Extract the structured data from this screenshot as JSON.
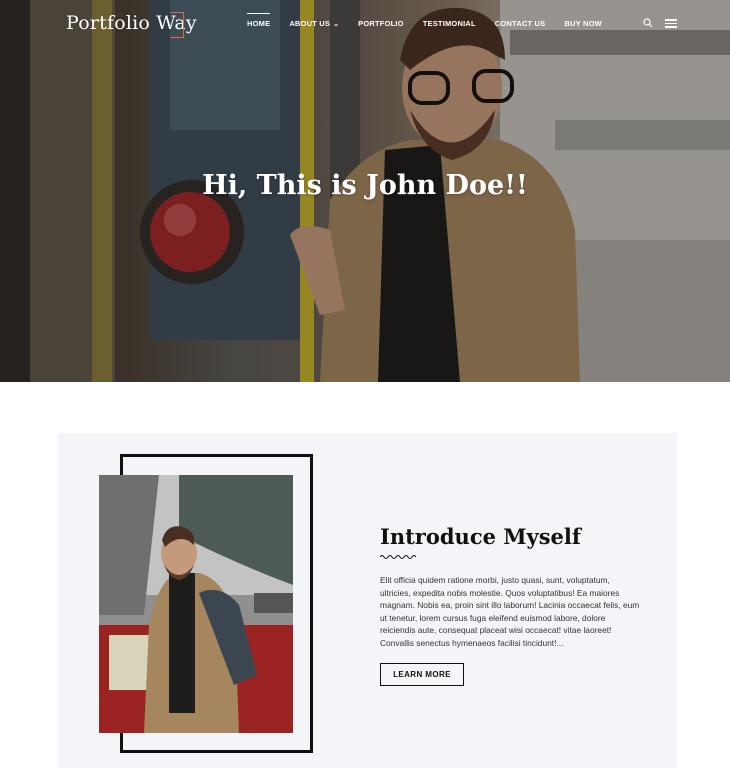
{
  "brand": {
    "logo_text": "Portfolio Way",
    "accent": "#d9694a"
  },
  "nav": {
    "items": [
      {
        "label": "HOME",
        "active": true
      },
      {
        "label": "ABOUT US",
        "has_dropdown": true
      },
      {
        "label": "PORTFOLIO"
      },
      {
        "label": "TESTIMONIAL"
      },
      {
        "label": "CONTACT US"
      },
      {
        "label": "BUY NOW"
      }
    ],
    "icons": [
      "search-icon",
      "menu-icon"
    ]
  },
  "hero": {
    "title": "Hi, This is John Doe!!"
  },
  "intro": {
    "heading": "Introduce Myself",
    "body": "Elit officia quidem ratione morbi, justo quasi, sunt, voluptatum, ultricies, expedita nobis molestie. Quos voluptatibus! Ea maiores magnam. Nobis ea, proin sint illo laborum! Lacinia occaecat felis, eum ut tenetur, lorem cursus fuga eleifend euismod labore, dolore reiciendis aute, consequat placeat wisi occaecat! vitae laoreet! Convallis senectus hymenaeos facilisi tincidunt!...",
    "button_label": "LEARN MORE",
    "background": "#f4f5f9"
  }
}
